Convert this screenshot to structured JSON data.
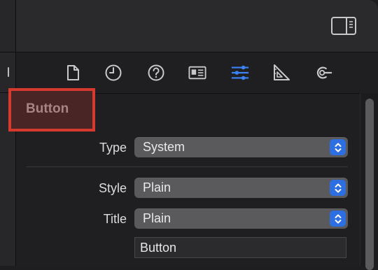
{
  "inspector": {
    "section_title": "Button",
    "tabs": [
      {
        "name": "file-icon"
      },
      {
        "name": "history-icon"
      },
      {
        "name": "help-icon"
      },
      {
        "name": "identity-card-icon"
      },
      {
        "name": "sliders-icon",
        "active": true
      },
      {
        "name": "ruler-icon"
      },
      {
        "name": "connections-icon"
      }
    ],
    "fields": {
      "type": {
        "label": "Type",
        "value": "System"
      },
      "style": {
        "label": "Style",
        "value": "Plain"
      },
      "title": {
        "label": "Title",
        "value": "Plain"
      },
      "title_text": {
        "value": "Button"
      }
    }
  },
  "colors": {
    "accent": "#2d6ee0",
    "active_tab": "#3b82f6",
    "highlight_border": "#d63a2e"
  }
}
